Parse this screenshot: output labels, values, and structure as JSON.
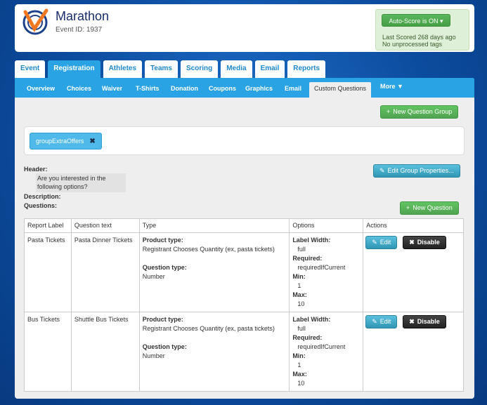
{
  "header": {
    "event_title": "Marathon",
    "event_id": "Event ID: 1937",
    "autoscore_label": "Auto-Score is ON",
    "caret": "▾",
    "last_scored": "Last Scored 268 days ago",
    "no_tags": "No unprocessed tags"
  },
  "top_tabs": [
    "Event",
    "Registration",
    "Athletes",
    "Teams",
    "Scoring",
    "Media",
    "Email",
    "Reports"
  ],
  "active_top_tab": "Registration",
  "sub_tabs": [
    "Overview",
    "Choices",
    "Waiver",
    "T-Shirts",
    "Donation",
    "Coupons",
    "Graphics",
    "Email",
    "Custom Questions",
    "More ▼"
  ],
  "active_sub_tab": "Custom Questions",
  "buttons": {
    "new_question_group": "New Question Group",
    "edit_group_properties": "Edit Group Properties...",
    "new_question": "New Question",
    "edit": "Edit",
    "disable": "Disable"
  },
  "group_chip": {
    "label": "groupExtraOffers",
    "close": "✖"
  },
  "group_details": {
    "header_label": "Header:",
    "header_text_line1": "Are you interested in the",
    "header_text_line2": "following options?",
    "description_label": "Description:",
    "questions_label": "Questions:"
  },
  "table": {
    "columns": [
      "Report Label",
      "Question text",
      "Type",
      "Options",
      "Actions"
    ],
    "rows": [
      {
        "report_label": "Pasta Tickets",
        "question_text": "Pasta Dinner Tickets",
        "product_type_label": "Product type:",
        "product_type": "Registrant Chooses Quantity (ex, pasta tickets)",
        "question_type_label": "Question type:",
        "question_type": "Number",
        "label_width_label": "Label Width:",
        "label_width": "full",
        "required_label": "Required:",
        "required": "requiredIfCurrent",
        "min_label": "Min:",
        "min": "1",
        "max_label": "Max:",
        "max": "10"
      },
      {
        "report_label": "Bus Tickets",
        "question_text": "Shuttle Bus Tickets",
        "product_type_label": "Product type:",
        "product_type": "Registrant Chooses Quantity (ex, pasta tickets)",
        "question_type_label": "Question type:",
        "question_type": "Number",
        "label_width_label": "Label Width:",
        "label_width": "full",
        "required_label": "Required:",
        "required": "requiredIfCurrent",
        "min_label": "Min:",
        "min": "1",
        "max_label": "Max:",
        "max": "10"
      }
    ]
  },
  "icons": {
    "plus": "+",
    "pencil": "✎",
    "x": "✖"
  },
  "colors": {
    "accent_blue": "#29a3e3",
    "green": "#51a351",
    "dark": "#222222"
  }
}
